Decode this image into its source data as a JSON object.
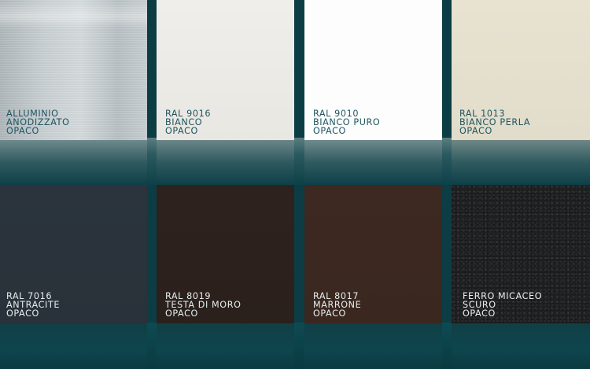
{
  "swatches": [
    {
      "line1": "ALLUMINIO",
      "line2": "ANODIZZATO",
      "line3": "OPACO",
      "color": "#c3c9cc",
      "texture": "brushed-aluminium"
    },
    {
      "line1": "RAL 9016",
      "line2": "BIANCO",
      "line3": "OPACO",
      "color": "#ebe9e4"
    },
    {
      "line1": "RAL 9010",
      "line2": "BIANCO PURO",
      "line3": "OPACO",
      "color": "#fdfdfd"
    },
    {
      "line1": "RAL 1013",
      "line2": "BIANCO PERLA",
      "line3": "OPACO",
      "color": "#e5dfcd"
    },
    {
      "line1": "RAL 7016",
      "line2": "ANTRACITE",
      "line3": "OPACO",
      "color": "#2a333b"
    },
    {
      "line1": "RAL 8019",
      "line2": "TESTA DI MORO",
      "line3": "OPACO",
      "color": "#2c211d"
    },
    {
      "line1": "RAL 8017",
      "line2": "MARRONE",
      "line3": "OPACO",
      "color": "#3c2820"
    },
    {
      "line1": "FERRO MICACEO",
      "line2": "SCURO",
      "line3": "OPACO",
      "color": "#1e1f20",
      "texture": "mica-grain"
    }
  ],
  "colors": {
    "background": "#0c3d44",
    "label_on_light": "#1f5560",
    "label_on_dark": "#e6eeef"
  }
}
